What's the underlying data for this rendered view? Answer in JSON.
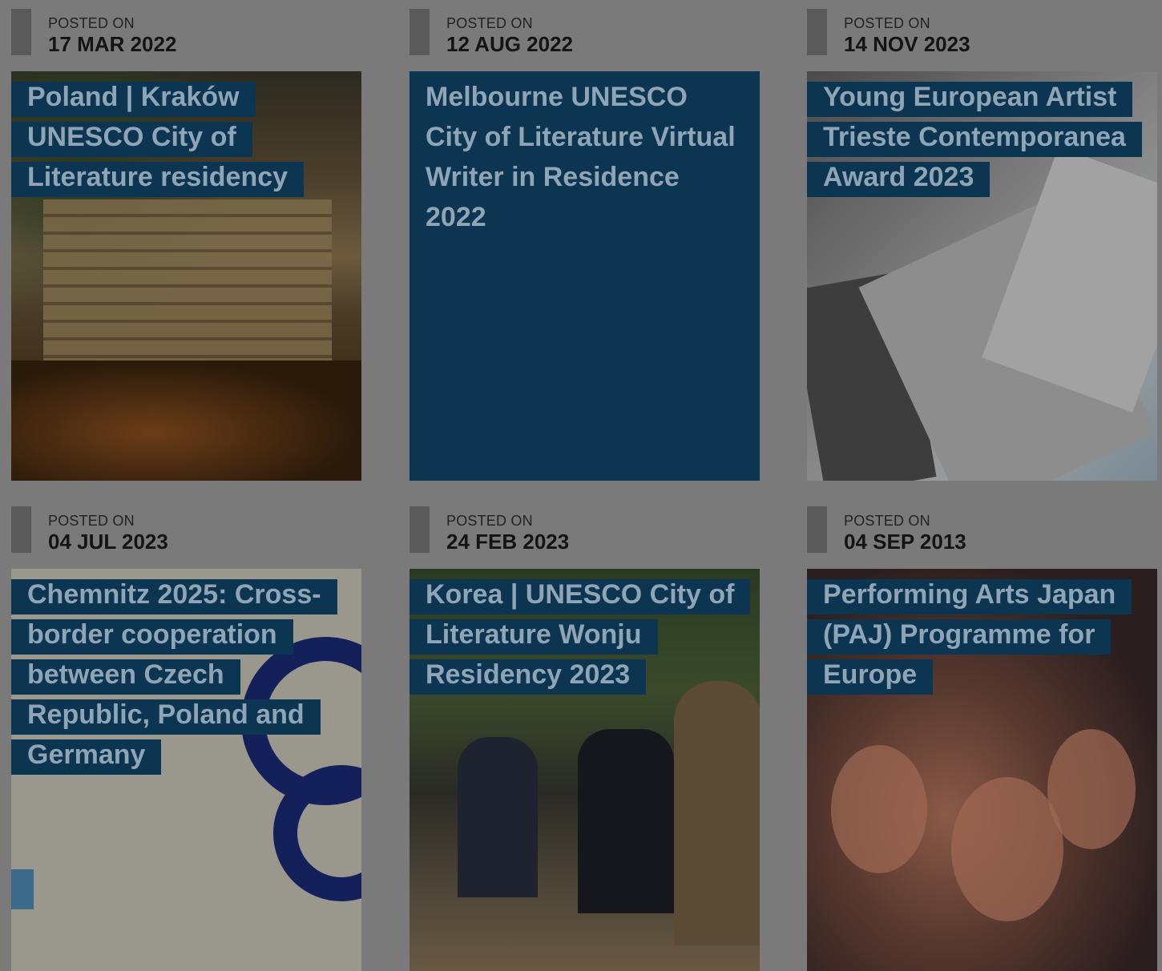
{
  "posted_label": "POSTED ON",
  "cards": [
    {
      "date": "17 MAR 2022",
      "title": "Poland | Kraków UNESCO City of Literature residency",
      "image": "krakow-villa-autumn-photo"
    },
    {
      "date": "12 AUG 2022",
      "title": "Melbourne UNESCO City of Literature Virtual Writer in Residence 2022",
      "image": "none"
    },
    {
      "date": "14 NOV 2023",
      "title": "Young European Artist Trieste Contemporanea Award 2023",
      "image": "books-on-table-photo"
    },
    {
      "date": "04 JUL 2023",
      "title": "Chemnitz 2025: Cross-border cooperation between Czech Republic, Poland and Germany",
      "image": "chemnitz-2025-logo-graphic"
    },
    {
      "date": "24 FEB 2023",
      "title": "Korea | UNESCO City of Literature Wonju Residency 2023",
      "image": "wonju-writers-park-photo"
    },
    {
      "date": "04 SEP 2013",
      "title": "Performing Arts Japan (PAJ) Programme for Europe",
      "image": "performers-crowd-photo"
    }
  ],
  "colors": {
    "overlay": "#7a7a7a",
    "title_bg": "#0b3550",
    "title_text": "#8fa5b5",
    "date_bar": "#5a5a5a"
  }
}
